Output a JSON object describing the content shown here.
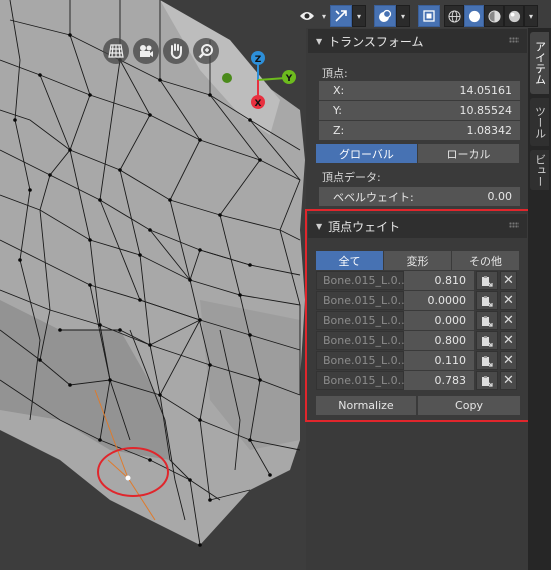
{
  "header": {
    "tool_icons": [
      "eye-icon",
      "cursor-icon",
      "overlay-icon",
      "xray-icon",
      "wireframe-icon",
      "solid-icon",
      "material-icon",
      "rendered-icon"
    ]
  },
  "gizmo": {
    "axes": [
      "Z",
      "Y",
      "X"
    ],
    "nav_icons": [
      "grid-icon",
      "camera-icon",
      "hand-icon",
      "zoom-icon"
    ],
    "colors": {
      "x": "#e8303f",
      "y": "#6dbb1e",
      "z": "#2d8fd9"
    }
  },
  "tabs": [
    "アイテム",
    "ツール",
    "ビュー"
  ],
  "transform": {
    "title": "トランスフォーム",
    "vertex_label": "頂点:",
    "x_label": "X:",
    "x": "14.05161",
    "y_label": "Y:",
    "y": "10.85524",
    "z_label": "Z:",
    "z": "1.08342",
    "global": "グローバル",
    "local": "ローカル",
    "vertex_data_label": "頂点データ:",
    "bevel_label": "ベベルウェイト:",
    "bevel": "0.00"
  },
  "vertex_weights": {
    "title": "頂点ウェイト",
    "tabs": [
      "全て",
      "変形",
      "その他"
    ],
    "rows": [
      {
        "bone": "Bone.015_L.0..",
        "weight": "0.810"
      },
      {
        "bone": "Bone.015_L.0..",
        "weight": "0.0000"
      },
      {
        "bone": "Bone.015_L.0..",
        "weight": "0.000"
      },
      {
        "bone": "Bone.015_L.0..",
        "weight": "0.800"
      },
      {
        "bone": "Bone.015_L.0..",
        "weight": "0.110"
      },
      {
        "bone": "Bone.015_L.0..",
        "weight": "0.783"
      }
    ],
    "normalize": "Normalize",
    "copy": "Copy"
  },
  "colors": {
    "accent": "#4772b3",
    "highlight": "#e0262c",
    "edge_selected": "#e07a2a"
  }
}
